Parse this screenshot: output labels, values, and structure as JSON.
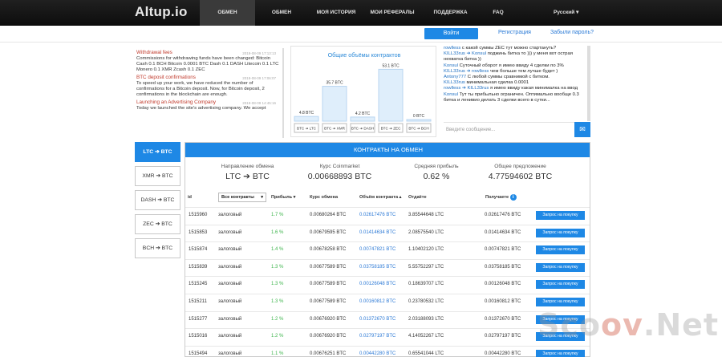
{
  "header": {
    "logo": "Altup.io",
    "nav": [
      "ОБМЕН АЛЬТКОЙНОВ",
      "ОБМЕН БИТКОЙНОВ",
      "МОЯ ИСТОРИЯ",
      "МОИ РЕФЕРАЛЫ",
      "ПОДДЕРЖКА",
      "FAQ"
    ],
    "lang": "Русский"
  },
  "auth": {
    "login": "Войти",
    "register": "Регистрация",
    "forgot": "Забыли пароль?"
  },
  "news": [
    {
      "title": "Withdrawal fees",
      "date": "2019-08-09 17:13:13",
      "body": "Commissions for withdrawing funds have been changed: Bitcoin Cash 0.1 BCH Bitcoin 0.0001 BTC Dash 0.1 DASH Litecoin 0.1 LTC Monero 0.1 XMR Zcash 0.1 ZEC"
    },
    {
      "title": "BTC deposit confirmations",
      "date": "2019-08-09 17:06:07",
      "body": "To speed up your work, we have reduced the number of confirmations for a Bitcoin deposit. Now, for Bitcoin deposit, 2 confirmations in the blockchain are enough."
    },
    {
      "title": "Launching an Advertising Company",
      "date": "2019-08-09 14:45:16",
      "body": "Today we launched the site's advertising company. We accept"
    }
  ],
  "volume_chart": {
    "title": "Общие объёмы контрактов"
  },
  "chart_data": {
    "type": "bar",
    "title": "Общие объёмы контрактов",
    "categories": [
      "BTC ➔ LTC",
      "BTC ➔ XMR",
      "BTC ➔ DASH",
      "BTC ➔ ZEC",
      "BTC ➔ BCH"
    ],
    "values": [
      4.8,
      35.7,
      4.2,
      53.1,
      0
    ],
    "labels": [
      "4.8 BTC",
      "35.7 BTC",
      "4.2 BTC",
      "53.1 BTC",
      "0 BTC"
    ],
    "ylim": [
      0,
      60
    ]
  },
  "chat": [
    {
      "n": "rowlless",
      "t": " с какой суммы ZEC тут можно стартануть?"
    },
    {
      "n": "KILL33rus ➔ Konsul",
      "t": " поджинь битка то ))) у меня вот острая нехватка битка ))"
    },
    {
      "n": "Konsul",
      "t": " Суточный оборот я имею ввиду 4 сделки по 3%"
    },
    {
      "n": "KILL33rus ➔ rowlless",
      "t": " чем больше тем лучше будет )"
    },
    {
      "n": "Antony777",
      "t": " С любой суммы сравнимой с битком."
    },
    {
      "n": "KILL33rus",
      "t": " минимальная сделка 0.0001"
    },
    {
      "n": "rowlless ➔ KILL33rus",
      "t": " я имею ввиду какая минималка на ввод"
    },
    {
      "n": "Konsul",
      "t": " Тут ты прибыльно ограничен. Оптимально вообще 0.3 битка и ленивио делать 3 сделки всего в сутки..."
    }
  ],
  "chat_input": {
    "placeholder": "Введите сообщение..."
  },
  "pairs": [
    "LTC ➔ BTC",
    "XMR ➔ BTC",
    "DASH ➔ BTC",
    "ZEC ➔ BTC",
    "BCH ➔ BTC"
  ],
  "panel": {
    "title": "КОНТРАКТЫ НА ОБМЕН",
    "stats": [
      {
        "label": "Направление обмена",
        "value": "LTC ➔ BTC"
      },
      {
        "label": "Курс Coinmarket",
        "value": "0.00668893 BTC"
      },
      {
        "label": "Средняя прибыль",
        "value": "0.62 %"
      },
      {
        "label": "Общее предложение",
        "value": "4.77594602 BTC"
      }
    ]
  },
  "table": {
    "headers": [
      "id",
      "Все контракты",
      "Прибыль",
      "Курс обмена",
      "Объём контракта",
      "Отдаёте",
      "Получаете"
    ],
    "button": "Запрос на покупку",
    "rows": [
      [
        "1515960",
        "залоговый",
        "1.7 %",
        "0.00680264 BTC",
        "0.02617476 BTC",
        "3.85544648 LTC",
        "0.02617476 BTC"
      ],
      [
        "1515853",
        "залоговый",
        "1.6 %",
        "0.00679595 BTC",
        "0.01414634 BTC",
        "2.08575540 LTC",
        "0.01414634 BTC"
      ],
      [
        "1515874",
        "залоговый",
        "1.4 %",
        "0.00678258 BTC",
        "0.00747821 BTC",
        "1.10402120 LTC",
        "0.00747821 BTC"
      ],
      [
        "1515839",
        "залоговый",
        "1.3 %",
        "0.00677589 BTC",
        "0.03758185 BTC",
        "5.55752297 LTC",
        "0.03758185 BTC"
      ],
      [
        "1515245",
        "залоговый",
        "1.3 %",
        "0.00677589 BTC",
        "0.00126048 BTC",
        "0.18639707 LTC",
        "0.00126048 BTC"
      ],
      [
        "1515211",
        "залоговый",
        "1.3 %",
        "0.00677589 BTC",
        "0.00160812 BTC",
        "0.23780532 LTC",
        "0.00160812 BTC"
      ],
      [
        "1515277",
        "залоговый",
        "1.2 %",
        "0.00676920 BTC",
        "0.01372670 BTC",
        "2.03188093 LTC",
        "0.01372670 BTC"
      ],
      [
        "1515016",
        "залоговый",
        "1.2 %",
        "0.00676920 BTC",
        "0.02797197 BTC",
        "4.14052267 LTC",
        "0.02797197 BTC"
      ],
      [
        "1515494",
        "залоговый",
        "1.1 %",
        "0.00676251 BTC",
        "0.00442280 BTC",
        "0.65541044 LTC",
        "0.00442280 BTC"
      ]
    ]
  },
  "watermark": {
    "a": "Sco",
    "b": "ov",
    "c": ".Net"
  }
}
